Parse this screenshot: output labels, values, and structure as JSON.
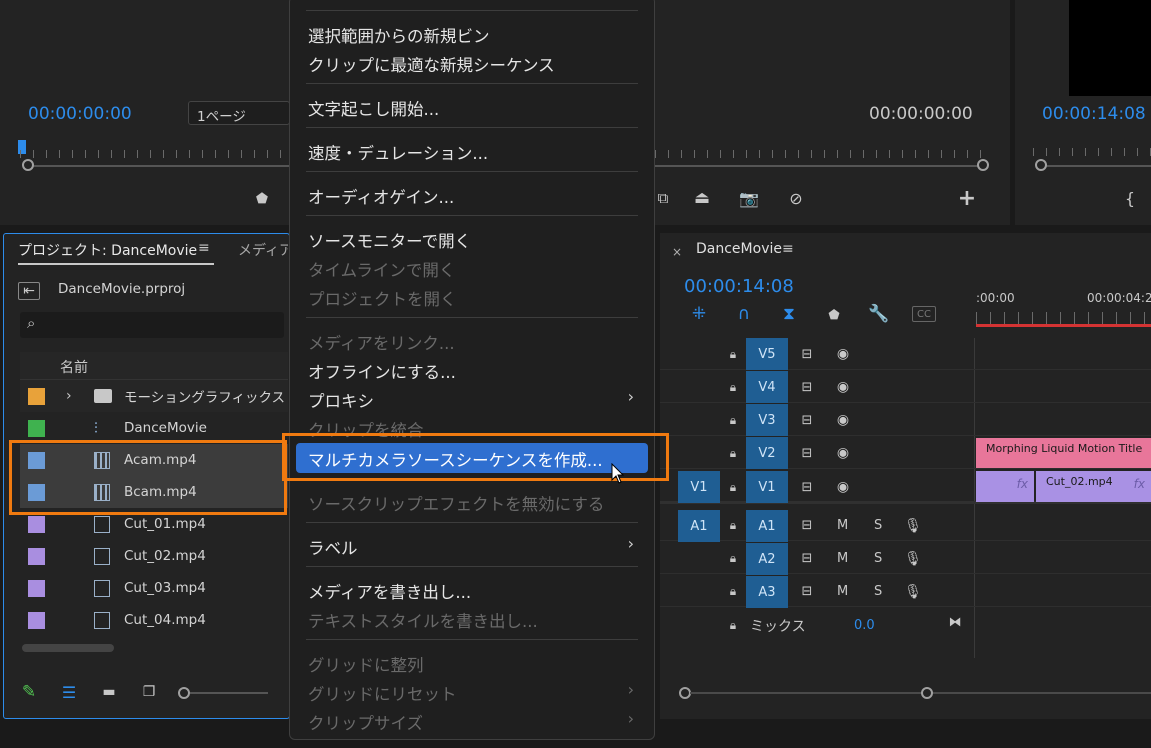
{
  "source_monitor": {
    "timecode": "00:00:00:00",
    "page_select": "1ページ"
  },
  "program_monitor": {
    "timecode": "00:00:00:00",
    "timecode2": "00:00:14:08"
  },
  "project_panel": {
    "tab_title": "プロジェクト: DanceMovie",
    "tab2": "メディア",
    "file_name": "DanceMovie.prproj",
    "column_name": "名前",
    "items": [
      {
        "label": "モーショングラフィックス",
        "color": "#e8a23a",
        "type": "folder"
      },
      {
        "label": "DanceMovie",
        "color": "#3fb24f",
        "type": "sequence"
      },
      {
        "label": "Acam.mp4",
        "color": "#6b9bd6",
        "type": "multicam"
      },
      {
        "label": "Bcam.mp4",
        "color": "#6b9bd6",
        "type": "multicam"
      },
      {
        "label": "Cut_01.mp4",
        "color": "#a98ee0",
        "type": "film"
      },
      {
        "label": "Cut_02.mp4",
        "color": "#a98ee0",
        "type": "film"
      },
      {
        "label": "Cut_03.mp4",
        "color": "#a98ee0",
        "type": "film"
      },
      {
        "label": "Cut_04.mp4",
        "color": "#a98ee0",
        "type": "film"
      }
    ]
  },
  "context_menu": {
    "new_bin": "選択範囲からの新規ビン",
    "new_sequence": "クリップに最適な新規シーケンス",
    "transcribe": "文字起こし開始...",
    "speed": "速度・デュレーション...",
    "audio_gain": "オーディオゲイン...",
    "open_source": "ソースモニターで開く",
    "open_timeline": "タイムラインで開く",
    "open_project": "プロジェクトを開く",
    "link_media": "メディアをリンク...",
    "make_offline": "オフラインにする...",
    "proxy": "プロキシ",
    "merge_clips": "クリップを統合",
    "multicam": "マルチカメラソースシーケンスを作成...",
    "disable_effects": "ソースクリップエフェクトを無効にする",
    "label": "ラベル",
    "export_media": "メディアを書き出し...",
    "export_text": "テキストスタイルを書き出し...",
    "align_grid": "グリッドに整列",
    "reset_grid": "グリッドにリセット",
    "clip_size": "クリップサイズ"
  },
  "timeline": {
    "tab_title": "DanceMovie",
    "timecode": "00:00:14:08",
    "ruler_start": ":00:00",
    "ruler_next": "00:00:04:2",
    "video_tracks": [
      "V5",
      "V4",
      "V3",
      "V2",
      "V1"
    ],
    "source_video": "V1",
    "source_audio": "A1",
    "audio_tracks": [
      "A1",
      "A2",
      "A3"
    ],
    "mute": "M",
    "solo": "S",
    "mix_label": "ミックス",
    "mix_value": "0.0",
    "clip_title": "Morphing Liquid Motion Title",
    "clip_cut02": "Cut_02.mp4",
    "fx": "fx",
    "cc": "CC"
  },
  "colors": {
    "accent_blue": "#2d8ceb",
    "highlight_orange": "#f07a10",
    "menu_selected": "#2f6fd0"
  }
}
